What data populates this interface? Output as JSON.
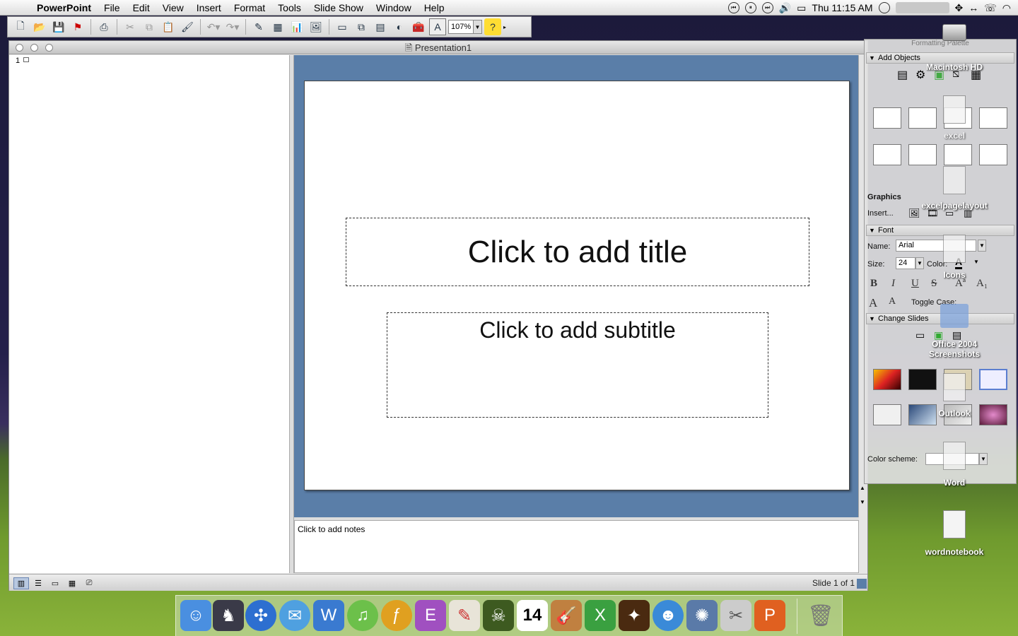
{
  "menubar": {
    "app_name": "PowerPoint",
    "menus": [
      "File",
      "Edit",
      "View",
      "Insert",
      "Format",
      "Tools",
      "Slide Show",
      "Window",
      "Help"
    ],
    "clock": "Thu 11:15 AM"
  },
  "toolbar": {
    "zoom_value": "107%"
  },
  "window": {
    "title": "Presentation1",
    "outline_slide_number": "1",
    "slide": {
      "title_placeholder": "Click to add title",
      "subtitle_placeholder": "Click to add subtitle"
    },
    "notes_placeholder": "Click to add notes",
    "slide_count": "Slide 1 of 1"
  },
  "palette": {
    "title": "Formatting Palette",
    "sections": {
      "add_objects": "Add Objects",
      "graphics": "Graphics",
      "insert_label": "Insert...",
      "font": "Font",
      "change_slides": "Change Slides"
    },
    "font": {
      "name_label": "Name:",
      "name_value": "Arial",
      "size_label": "Size:",
      "size_value": "24",
      "color_label": "Color:",
      "toggle_case": "Toggle Case:"
    },
    "color_scheme_label": "Color scheme:"
  },
  "desktop": {
    "icons": [
      "Macintosh HD",
      "excel",
      "excelpagelayout",
      "Icons",
      "Office 2004 Screenshots",
      "Outlook",
      "Word",
      "wordnotebook"
    ]
  },
  "colors": {
    "slide_area_bg": "#5a7ea8",
    "desktop_green": "#8ab33a"
  }
}
